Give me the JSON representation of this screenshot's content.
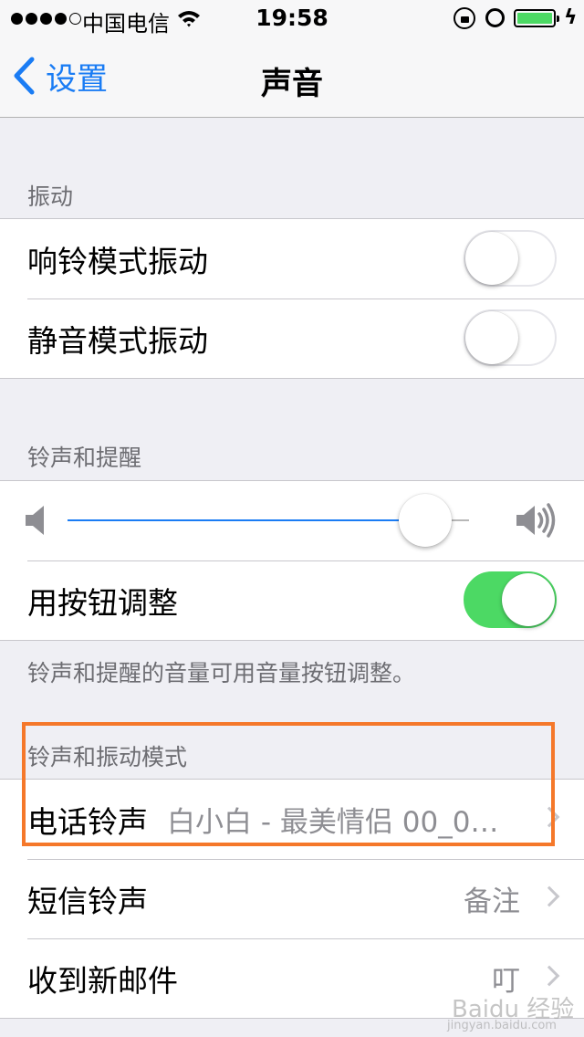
{
  "status_bar": {
    "carrier": "中国电信",
    "time": "19:58",
    "signal_bars": 4,
    "signal_total": 5,
    "battery_level": 1.0,
    "battery_color": "#4cd964"
  },
  "nav": {
    "back_label": "设置",
    "title": "声音",
    "accent_color": "#1a7cf4"
  },
  "vibration": {
    "header": "振动",
    "items": [
      {
        "label": "响铃模式振动",
        "on": false
      },
      {
        "label": "静音模式振动",
        "on": false
      }
    ]
  },
  "ringer_alerts": {
    "header": "铃声和提醒",
    "volume": 0.89,
    "change_with_buttons": {
      "label": "用按钮调整",
      "on": true
    },
    "footer": "铃声和提醒的音量可用音量按钮调整。"
  },
  "sounds_patterns": {
    "header": "铃声和振动模式",
    "items": [
      {
        "label": "电话铃声",
        "value": "白小白 - 最美情侣 00_0…"
      },
      {
        "label": "短信铃声",
        "value": "备注"
      },
      {
        "label": "收到新邮件",
        "value": "叮"
      }
    ]
  },
  "watermark": {
    "text": "Baidu 经验",
    "sub": "jingyan.baidu.com"
  }
}
